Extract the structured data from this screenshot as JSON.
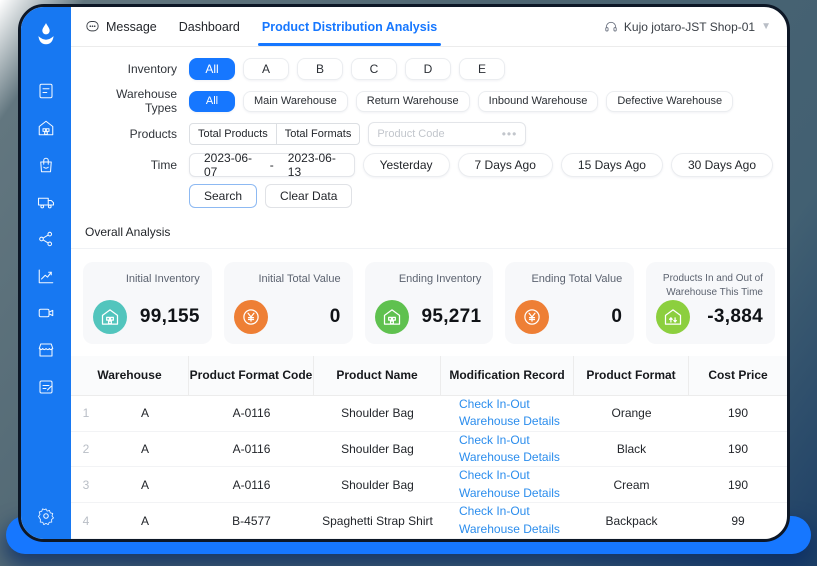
{
  "topbar": {
    "message": "Message",
    "dashboard": "Dashboard",
    "active_tab": "Product Distribution Analysis",
    "user": "Kujo jotaro-JST Shop-01"
  },
  "sidebar": {
    "icons": [
      "order-document-icon",
      "warehouse-home-icon",
      "shopping-bag-icon",
      "truck-icon",
      "share-network-icon",
      "trend-chart-icon",
      "video-camera-icon",
      "storefront-icon",
      "edit-note-icon",
      "gear-icon"
    ]
  },
  "filters": {
    "inventory": {
      "label": "Inventory",
      "options": [
        "All",
        "A",
        "B",
        "C",
        "D",
        "E"
      ],
      "active": "All"
    },
    "warehouse_types": {
      "label": "Warehouse Types",
      "options": [
        "All",
        "Main Warehouse",
        "Return Warehouse",
        "Inbound Warehouse",
        "Defective Warehouse"
      ],
      "active": "All"
    },
    "products": {
      "label": "Products",
      "segments": [
        "Total Products",
        "Total Formats"
      ],
      "input_placeholder": "Product Code",
      "ellipsis": "•••"
    },
    "time": {
      "label": "Time",
      "date_from": "2023-06-07",
      "date_to": "2023-06-13",
      "separator": "-",
      "presets": [
        "Yesterday",
        "7 Days Ago",
        "15 Days Ago",
        "30 Days Ago"
      ]
    },
    "search_label": "Search",
    "clear_label": "Clear Data"
  },
  "overall": {
    "title": "Overall Analysis",
    "cards": [
      {
        "label": "Initial Inventory",
        "value": "99,155",
        "icon": "warehouse-icon",
        "color": "#52c5bd"
      },
      {
        "label": "Initial Total Value",
        "value": "0",
        "icon": "yen-coin-icon",
        "color": "#ee7f35"
      },
      {
        "label": "Ending Inventory",
        "value": "95,271",
        "icon": "warehouse-icon",
        "color": "#5fc14f"
      },
      {
        "label": "Ending Total Value",
        "value": "0",
        "icon": "yen-coin-icon",
        "color": "#ee7f35"
      },
      {
        "label": "Products In and Out of Warehouse This Time",
        "value": "-3,884",
        "icon": "warehouse-arrows-icon",
        "color": "#8ccf3e"
      }
    ]
  },
  "table": {
    "headers": [
      "Warehouse",
      "Product Format Code",
      "Product Name",
      "Modification Record",
      "Product Format",
      "Cost Price"
    ],
    "rows": [
      {
        "num": "1",
        "warehouse": "A",
        "code": "A-0116",
        "name": "Shoulder Bag",
        "link": "Check In-Out Warehouse Details",
        "format": "Orange",
        "price": "190"
      },
      {
        "num": "2",
        "warehouse": "A",
        "code": "A-0116",
        "name": "Shoulder Bag",
        "link": "Check In-Out Warehouse Details",
        "format": "Black",
        "price": "190"
      },
      {
        "num": "3",
        "warehouse": "A",
        "code": "A-0116",
        "name": "Shoulder Bag",
        "link": "Check In-Out Warehouse Details",
        "format": "Cream",
        "price": "190"
      },
      {
        "num": "4",
        "warehouse": "A",
        "code": "B-4577",
        "name": "Spaghetti Strap Shirt",
        "link": "Check In-Out Warehouse Details",
        "format": "Backpack",
        "price": "99"
      }
    ]
  },
  "colors": {
    "primary": "#1677ff",
    "link": "#2b8ded",
    "teal": "#52c5bd",
    "orange": "#ee7f35",
    "green": "#5fc14f",
    "lime": "#8ccf3e",
    "backdrop": "#4c6471"
  }
}
